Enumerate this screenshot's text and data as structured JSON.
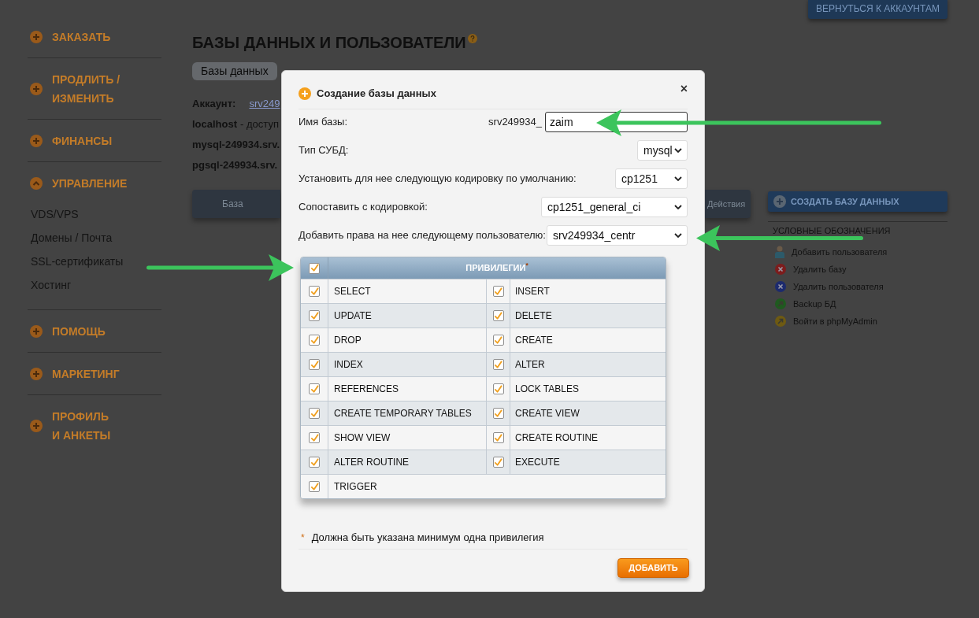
{
  "sidebar": {
    "sections": [
      {
        "label": "ЗАКАЗАТЬ",
        "expanded": false
      },
      {
        "label": "ПРОДЛИТЬ /\nИЗМЕНИТЬ",
        "expanded": false
      },
      {
        "label": "ФИНАНСЫ",
        "expanded": false
      },
      {
        "label": "УПРАВЛЕНИЕ",
        "expanded": true,
        "children": [
          {
            "label": "VDS/VPS"
          },
          {
            "label": "Домены / Почта"
          },
          {
            "label": "SSL-сертификаты"
          },
          {
            "label": "Хостинг"
          }
        ]
      },
      {
        "label": "ПОМОЩЬ",
        "expanded": false
      },
      {
        "label": "МАРКЕТИНГ",
        "expanded": false
      },
      {
        "label": "ПРОФИЛЬ\nИ АНКЕТЫ",
        "expanded": false
      }
    ]
  },
  "page": {
    "title": "БАЗЫ ДАННЫХ И ПОЛЬЗОВАТЕЛИ",
    "tabs": [
      {
        "label": "Базы данных",
        "selected": true
      }
    ],
    "account": {
      "label": "Аккаунт:",
      "link": "srv249"
    },
    "hosts": [
      {
        "host": "localhost",
        "note": "- доступ"
      },
      {
        "host": "mysql-249934.srv."
      },
      {
        "host": "pgsql-249934.srv."
      }
    ],
    "table": {
      "columns": [
        "База",
        "Действия"
      ]
    }
  },
  "right_panel": {
    "back_button": "ВЕРНУТЬСЯ К АККАУНТАМ",
    "create_button": "СОЗДАТЬ БАЗУ ДАННЫХ",
    "legend": {
      "title": "УСЛОВНЫЕ ОБОЗНАЧЕНИЯ",
      "items": [
        {
          "kind": "user",
          "color": "#2c5a6a",
          "label": "Добавить пользователя"
        },
        {
          "kind": "cross",
          "color": "#7d1c1c",
          "label": "Удалить базу"
        },
        {
          "kind": "cross",
          "color": "#1c2a6e",
          "label": "Удалить пользователя"
        },
        {
          "kind": "arrow",
          "color": "#1f5a1f",
          "label": "Backup БД"
        },
        {
          "kind": "arrow",
          "color": "#6e5a12",
          "label": "Войти в phpMyAdmin"
        }
      ]
    }
  },
  "dialog": {
    "title": "Создание базы данных",
    "close": "×",
    "fields": [
      {
        "kind": "text",
        "label": "Имя базы:",
        "prefix": "srv249934_",
        "value": "zaim"
      },
      {
        "kind": "select",
        "label": "Тип СУБД:",
        "value": "mysql"
      },
      {
        "kind": "select",
        "label": "Установить для нее следующую кодировку по умолчанию:",
        "value": "cp1251"
      },
      {
        "kind": "select",
        "label": "Сопоставить с кодировкой:",
        "value": "cp1251_general_ci"
      },
      {
        "kind": "select",
        "label": "Добавить права на нее следующему пользователю:",
        "value": "srv249934_centr"
      }
    ],
    "privileges": {
      "header": "ПРИВИЛЕГИИ$^{*}$",
      "all_checked": true,
      "items": [
        {
          "label": "SELECT",
          "checked": true
        },
        {
          "label": "INSERT",
          "checked": true
        },
        {
          "label": "UPDATE",
          "checked": true
        },
        {
          "label": "DELETE",
          "checked": true
        },
        {
          "label": "DROP",
          "checked": true
        },
        {
          "label": "CREATE",
          "checked": true
        },
        {
          "label": "INDEX",
          "checked": true
        },
        {
          "label": "ALTER",
          "checked": true
        },
        {
          "label": "REFERENCES",
          "checked": true
        },
        {
          "label": "LOCK TABLES",
          "checked": true
        },
        {
          "label": "CREATE TEMPORARY TABLES",
          "checked": true
        },
        {
          "label": "CREATE VIEW",
          "checked": true
        },
        {
          "label": "SHOW VIEW",
          "checked": true
        },
        {
          "label": "CREATE ROUTINE",
          "checked": true
        },
        {
          "label": "ALTER ROUTINE",
          "checked": true
        },
        {
          "label": "EXECUTE",
          "checked": true
        },
        {
          "label": "TRIGGER",
          "checked": true
        }
      ]
    },
    "note": {
      "mark": "*",
      "text": "Должна быть указана минимум одна привилегия"
    },
    "submit": "ДОБАВИТЬ"
  }
}
